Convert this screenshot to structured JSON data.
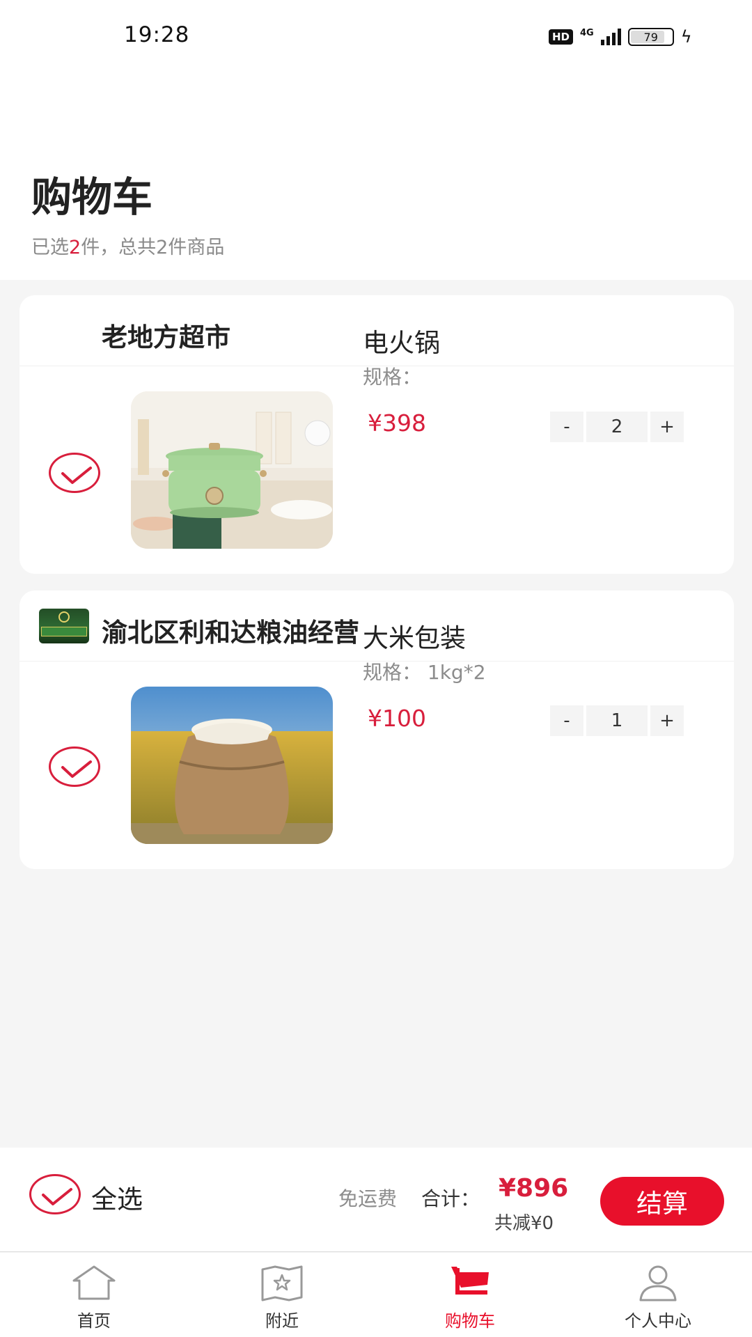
{
  "status": {
    "time": "19:28",
    "hd": "HD",
    "network": "4G",
    "battery": "79"
  },
  "header": {
    "title": "购物车",
    "subtitle_prefix": "已选",
    "selected_count": "2",
    "subtitle_suffix": "件，总共2件商品"
  },
  "stores": [
    {
      "name": "老地方超市",
      "item": {
        "name": "电火锅",
        "spec": "规格：",
        "price": "¥398",
        "qty": "2",
        "minus": "-",
        "plus": "+"
      }
    },
    {
      "name": "渝北区利和达粮油经营",
      "item": {
        "name": "大米包装",
        "spec": "规格：  1kg*2",
        "price": "¥100",
        "qty": "1",
        "minus": "-",
        "plus": "+"
      }
    }
  ],
  "bottom": {
    "select_all": "全选",
    "free_shipping": "免运费",
    "total_label": "合计：",
    "total": "¥896",
    "discount": "共减¥0",
    "checkout": "结算"
  },
  "tabs": [
    {
      "label": "首页",
      "icon": "home-icon"
    },
    {
      "label": "附近",
      "icon": "map-star-icon"
    },
    {
      "label": "购物车",
      "icon": "cart-icon"
    },
    {
      "label": "个人中心",
      "icon": "person-icon"
    }
  ],
  "colors": {
    "accent": "#e8102b",
    "price": "#d81e3c",
    "background": "#f5f5f5"
  }
}
